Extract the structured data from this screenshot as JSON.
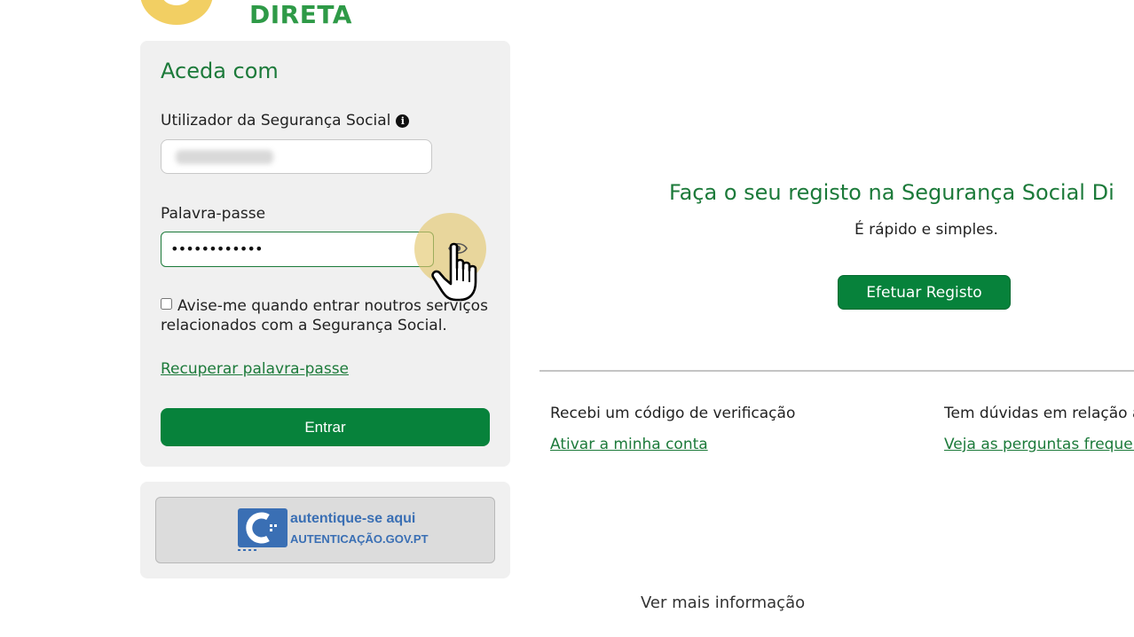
{
  "brand": {
    "logo_text": "DIRETA",
    "colors": {
      "primary": "#07823b",
      "heading": "#1c7a3a",
      "accent_logo": "#f2cf63"
    }
  },
  "login": {
    "title": "Aceda com",
    "user_label": "Utilizador da Segurança Social",
    "user_info_icon": "info-icon",
    "user_value_blurred": true,
    "password_label": "Palavra-passe",
    "password_value": "••••••••••••",
    "show_password_icon": "eye-icon",
    "remember_checked": false,
    "remember_label": "Avise-me quando entrar noutros serviços relacionados com a Segurança Social.",
    "recover_link": "Recuperar palavra-passe",
    "submit_label": "Entrar"
  },
  "auth_gov": {
    "line1": "autentique-se aqui",
    "line2": "AUTENTICAÇÃO.GOV.PT"
  },
  "register": {
    "title": "Faça o seu registo na Segurança Social Di",
    "subtitle": "É rápido e simples.",
    "button_label": "Efetuar Registo"
  },
  "verification": {
    "text": "Recebi um código de verificação",
    "link": "Ativar a minha conta"
  },
  "doubts": {
    "text": "Tem dúvidas em relação à",
    "link": "Veja as perguntas frequer"
  },
  "footer": {
    "more_info": "Ver mais informação"
  }
}
